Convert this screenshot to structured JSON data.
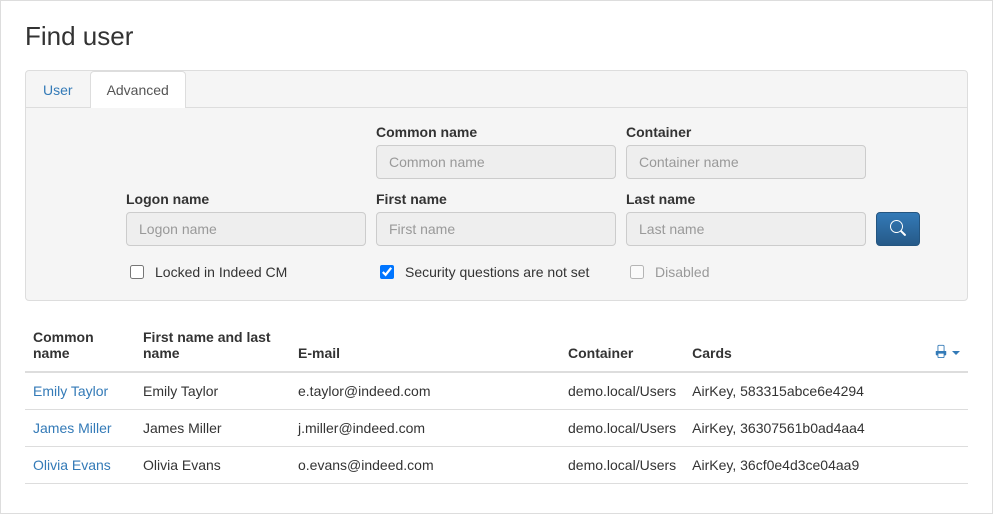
{
  "page": {
    "title": "Find user"
  },
  "tabs": {
    "user": "User",
    "advanced": "Advanced"
  },
  "form": {
    "common_name": {
      "label": "Common name",
      "placeholder": "Common name"
    },
    "container": {
      "label": "Container",
      "placeholder": "Container name"
    },
    "logon_name": {
      "label": "Logon name",
      "placeholder": "Logon name"
    },
    "first_name": {
      "label": "First name",
      "placeholder": "First name"
    },
    "last_name": {
      "label": "Last name",
      "placeholder": "Last name"
    }
  },
  "checkboxes": {
    "locked": {
      "label": "Locked in Indeed CM",
      "checked": false
    },
    "secq": {
      "label": "Security questions are not set",
      "checked": true
    },
    "disabled": {
      "label": "Disabled",
      "checked": false
    }
  },
  "columns": {
    "common_name": "Common name",
    "full_name": "First name and last name",
    "email": "E-mail",
    "container": "Container",
    "cards": "Cards"
  },
  "rows": [
    {
      "common_name": "Emily Taylor",
      "full_name": "Emily Taylor",
      "email": "e.taylor@indeed.com",
      "container": "demo.local/Users",
      "cards": "AirKey, 583315abce6e4294"
    },
    {
      "common_name": "James Miller",
      "full_name": "James Miller",
      "email": "j.miller@indeed.com",
      "container": "demo.local/Users",
      "cards": "AirKey, 36307561b0ad4aa4"
    },
    {
      "common_name": "Olivia Evans",
      "full_name": "Olivia Evans",
      "email": "o.evans@indeed.com",
      "container": "demo.local/Users",
      "cards": "AirKey, 36cf0e4d3ce04aa9"
    }
  ]
}
